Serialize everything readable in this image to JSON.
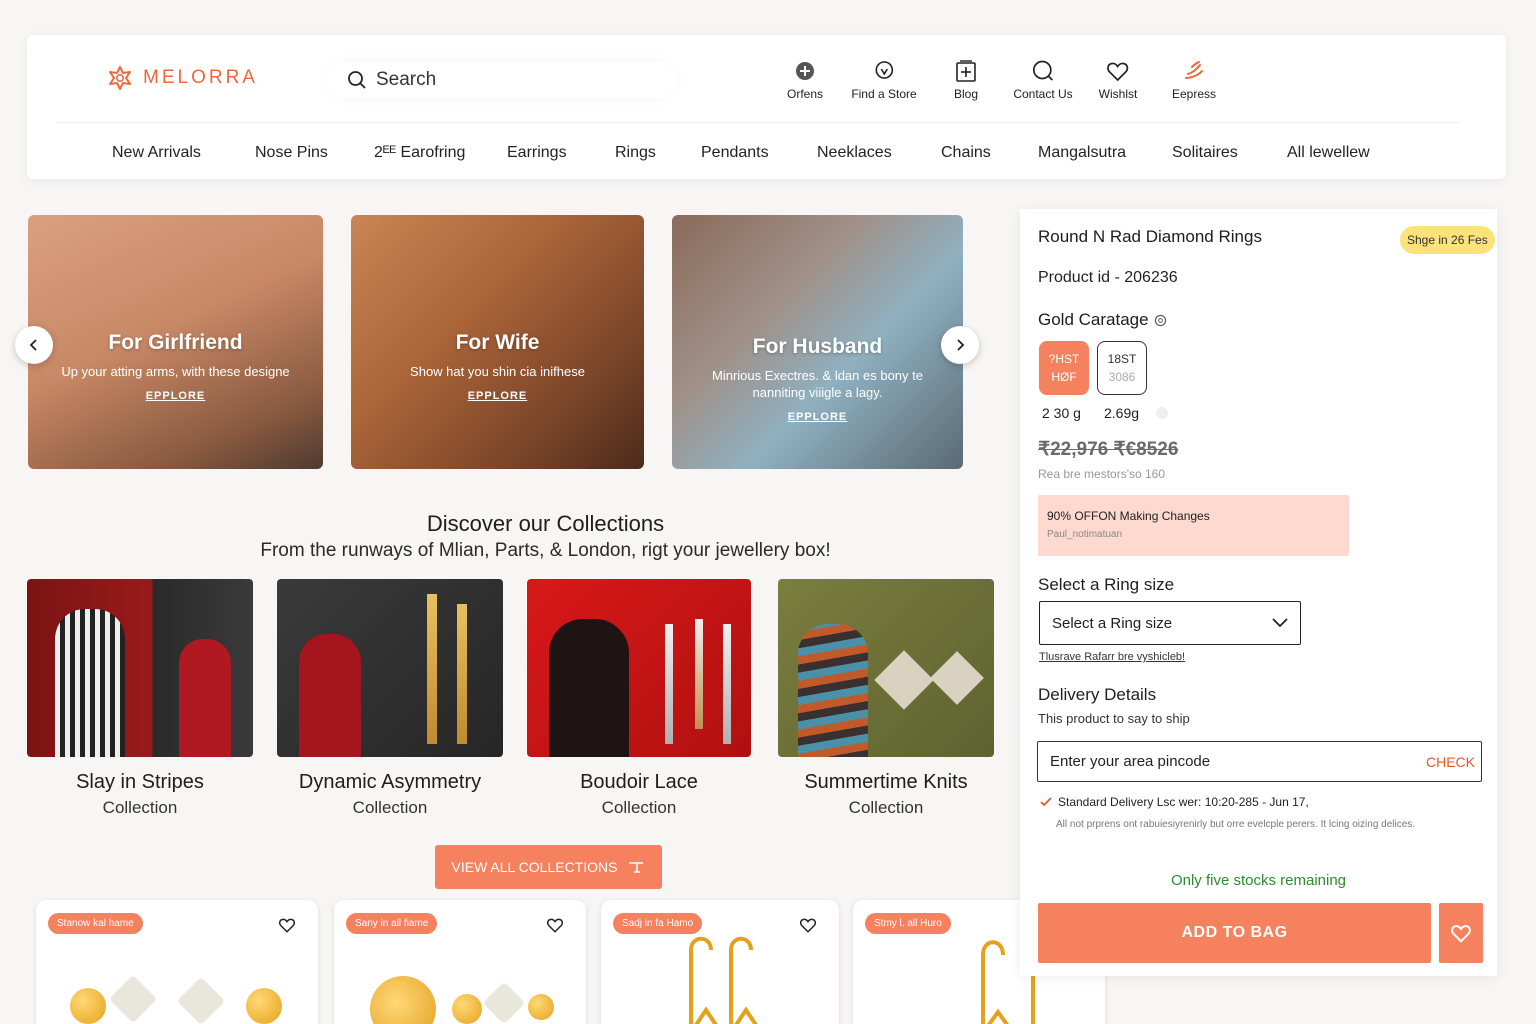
{
  "brand": {
    "name": "MELORRA",
    "color": "#f0673d"
  },
  "search": {
    "placeholder": "Search"
  },
  "header_icons": [
    {
      "label": "Orfens",
      "icon": "orders-icon"
    },
    {
      "label": "Find a Store",
      "icon": "location-pin-icon"
    },
    {
      "label": "Blog",
      "icon": "blog-icon"
    },
    {
      "label": "Contact Us",
      "icon": "search-circle-icon"
    },
    {
      "label": "Wishlst",
      "icon": "heart-icon"
    },
    {
      "label": "Eepress",
      "icon": "express-icon"
    }
  ],
  "nav": [
    "New Arrivals",
    "Nose Pins",
    "2ᴱᴱ Earofring",
    "Earrings",
    "Rings",
    "Pendants",
    "Neeklaces",
    "Chains",
    "Mangalsutra",
    "Solitaires",
    "All lewellew"
  ],
  "hero": [
    {
      "title": "For Girlfriend",
      "text": "Up your atting arms, with these designe",
      "cta": "EPPLORE"
    },
    {
      "title": "For Wife",
      "text": "Show hat you shin cia inifhese",
      "cta": "EPPLORE"
    },
    {
      "title": "For Husband",
      "text": "Minrious  Exectres. & ldan es bony te nanniting viiigle a lagy.",
      "cta": "EPPLORE"
    }
  ],
  "collections_section": {
    "title": "Discover our Collections",
    "subtitle": "From the runways of Mlian, Parts, & London, rigt your jewellery box!"
  },
  "collections": [
    {
      "name": "Slay in Stripes",
      "sub": "Collection"
    },
    {
      "name": "Dynamic Asymmetry",
      "sub": "Collection"
    },
    {
      "name": "Boudoir Lace",
      "sub": "Collection"
    },
    {
      "name": "Summertime Knits",
      "sub": "Collection"
    }
  ],
  "view_all": "VIEW ALL COLLECTIONS",
  "product_badges": [
    "Stanow kal hame",
    "Sany in all fiame",
    "Sadj in fa Hamo",
    "Stmy l. all Huro"
  ],
  "panel": {
    "title": "Round N Rad Diamond Rings",
    "ship_badge": "Shge in 26 Fes",
    "product_id": "Product id  - 206236",
    "carat_label": "Gold Caratage",
    "carats": [
      {
        "top": "?HST",
        "bottom": "HØF",
        "weight": "2 30 g",
        "selected": true
      },
      {
        "top": "18ST",
        "bottom": "3086",
        "weight": "2.69g",
        "selected": false
      }
    ],
    "price": "₹22,976 ₹€8526",
    "price_note": "Rea bre mestors'so 160",
    "offer_title": "90% OFFON Making Changes",
    "offer_sub": "Paul_notimatuan",
    "ring_size_label": "Select a Ring size",
    "ring_size_value": "Select a Ring size",
    "ring_size_link": "Tlusrave Rafarr bre vyshicleb!",
    "delivery_label": "Delivery Details",
    "delivery_sub": "This product to say to ship",
    "pin_placeholder": "Enter your area pincode",
    "check": "CHECK",
    "standard_delivery": "Standard Delivery Lsc wer: 10:20-285 - Jun 17,",
    "delivery_note": "All not prprens ont rabuiesiyrenirly but orre evelcple perers. It lcing oizing delices.",
    "stock": "Only five stocks remaining",
    "add_to_bag": "ADD TO BAG"
  },
  "colors": {
    "accent": "#f5815f",
    "offer_bg": "#fdd9d0",
    "badge": "#fbe27a",
    "stock": "#2e8b2e"
  }
}
